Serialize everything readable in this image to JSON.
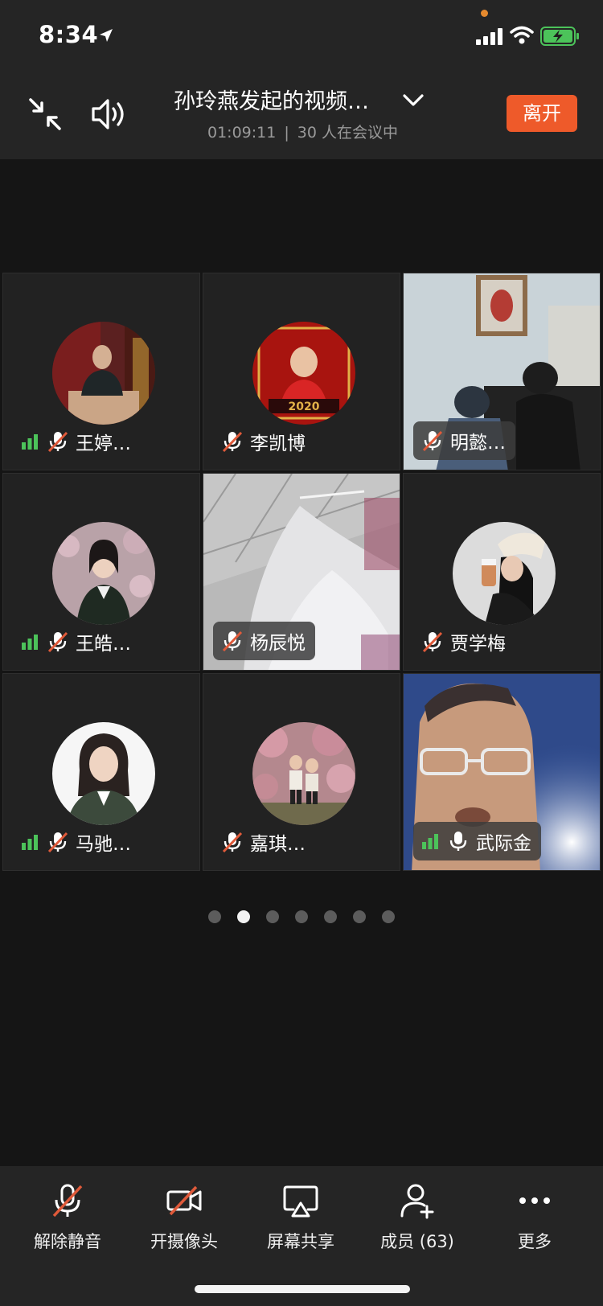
{
  "status_bar": {
    "time": "8:34"
  },
  "header": {
    "title": "孙玲燕发起的视频…",
    "duration": "01:09:11",
    "separator": "|",
    "participants_in_meeting": "30 人在会议中",
    "leave_label": "离开"
  },
  "grid": {
    "tiles": [
      {
        "name": "王婷…",
        "signal": true,
        "mic_muted": true
      },
      {
        "name": "李凯博",
        "signal": false,
        "mic_muted": true
      },
      {
        "name": "明懿…",
        "signal": false,
        "mic_muted": true
      },
      {
        "name": "王皓…",
        "signal": true,
        "mic_muted": true
      },
      {
        "name": "杨辰悦",
        "signal": false,
        "mic_muted": true
      },
      {
        "name": "贾学梅",
        "signal": false,
        "mic_muted": true
      },
      {
        "name": "马驰…",
        "signal": true,
        "mic_muted": true
      },
      {
        "name": "嘉琪…",
        "signal": false,
        "mic_muted": true
      },
      {
        "name": "武际金",
        "signal": true,
        "mic_muted": false
      }
    ]
  },
  "pagination": {
    "total": 7,
    "current": 2
  },
  "toolbar": {
    "unmute_label": "解除静音",
    "camera_label": "开摄像头",
    "share_label": "屏幕共享",
    "members_label": "成员 (63)",
    "more_label": "更多"
  },
  "colors": {
    "leave_button": "#ee5a2a",
    "signal_green": "#4cc35a",
    "mute_slash": "#e05a3a",
    "background": "#151515",
    "bar_background": "#252525"
  }
}
